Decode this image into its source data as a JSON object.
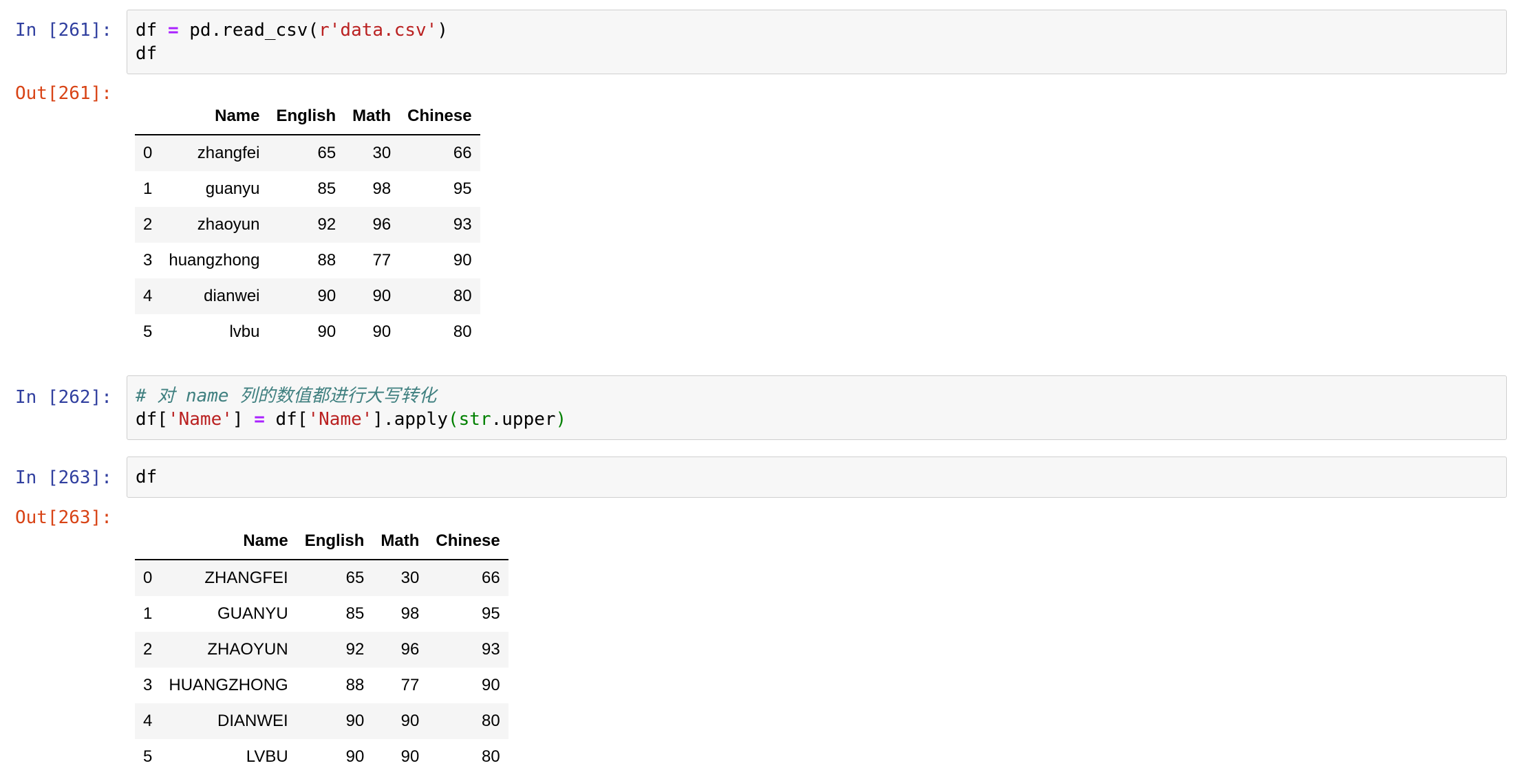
{
  "cells": [
    {
      "in_prompt": "In [261]:",
      "code_lines": [
        [
          {
            "t": "df ",
            "c": "tok-plain"
          },
          {
            "t": "=",
            "c": "tok-op"
          },
          {
            "t": " pd.read_csv(",
            "c": "tok-plain"
          },
          {
            "t": "r'data.csv'",
            "c": "tok-str"
          },
          {
            "t": ")",
            "c": "tok-plain"
          }
        ],
        [
          {
            "t": "df",
            "c": "tok-plain"
          }
        ]
      ],
      "out_prompt": "Out[261]:",
      "table": {
        "columns": [
          "",
          "Name",
          "English",
          "Math",
          "Chinese"
        ],
        "rows": [
          [
            "0",
            "zhangfei",
            "65",
            "30",
            "66"
          ],
          [
            "1",
            "guanyu",
            "85",
            "98",
            "95"
          ],
          [
            "2",
            "zhaoyun",
            "92",
            "96",
            "93"
          ],
          [
            "3",
            "huangzhong",
            "88",
            "77",
            "90"
          ],
          [
            "4",
            "dianwei",
            "90",
            "90",
            "80"
          ],
          [
            "5",
            "lvbu",
            "90",
            "90",
            "80"
          ]
        ]
      }
    },
    {
      "in_prompt": "In [262]:",
      "code_lines": [
        [
          {
            "t": "# 对 name 列的数值都进行大写转化",
            "c": "tok-comment"
          }
        ],
        [
          {
            "t": "df[",
            "c": "tok-plain"
          },
          {
            "t": "'Name'",
            "c": "tok-str"
          },
          {
            "t": "] ",
            "c": "tok-plain"
          },
          {
            "t": "=",
            "c": "tok-op"
          },
          {
            "t": " df[",
            "c": "tok-plain"
          },
          {
            "t": "'Name'",
            "c": "tok-str"
          },
          {
            "t": "].apply",
            "c": "tok-plain"
          },
          {
            "t": "(str",
            "c": "tok-builtin"
          },
          {
            "t": ".upper",
            "c": "tok-plain"
          },
          {
            "t": ")",
            "c": "tok-builtin"
          }
        ]
      ]
    },
    {
      "in_prompt": "In [263]:",
      "code_lines": [
        [
          {
            "t": "df",
            "c": "tok-plain"
          }
        ]
      ],
      "out_prompt": "Out[263]:",
      "table": {
        "columns": [
          "",
          "Name",
          "English",
          "Math",
          "Chinese"
        ],
        "rows": [
          [
            "0",
            "ZHANGFEI",
            "65",
            "30",
            "66"
          ],
          [
            "1",
            "GUANYU",
            "85",
            "98",
            "95"
          ],
          [
            "2",
            "ZHAOYUN",
            "92",
            "96",
            "93"
          ],
          [
            "3",
            "HUANGZHONG",
            "88",
            "77",
            "90"
          ],
          [
            "4",
            "DIANWEI",
            "90",
            "90",
            "80"
          ],
          [
            "5",
            "LVBU",
            "90",
            "90",
            "80"
          ]
        ]
      }
    }
  ],
  "colors": {
    "in_prompt": "#303F9F",
    "out_prompt": "#D84315",
    "operator": "#AA22FF",
    "string": "#BA2121",
    "builtin": "#008000",
    "comment": "#408080",
    "input_background": "#f7f7f7",
    "input_border": "#cfcfcf",
    "table_stripe": "#f5f5f5"
  }
}
